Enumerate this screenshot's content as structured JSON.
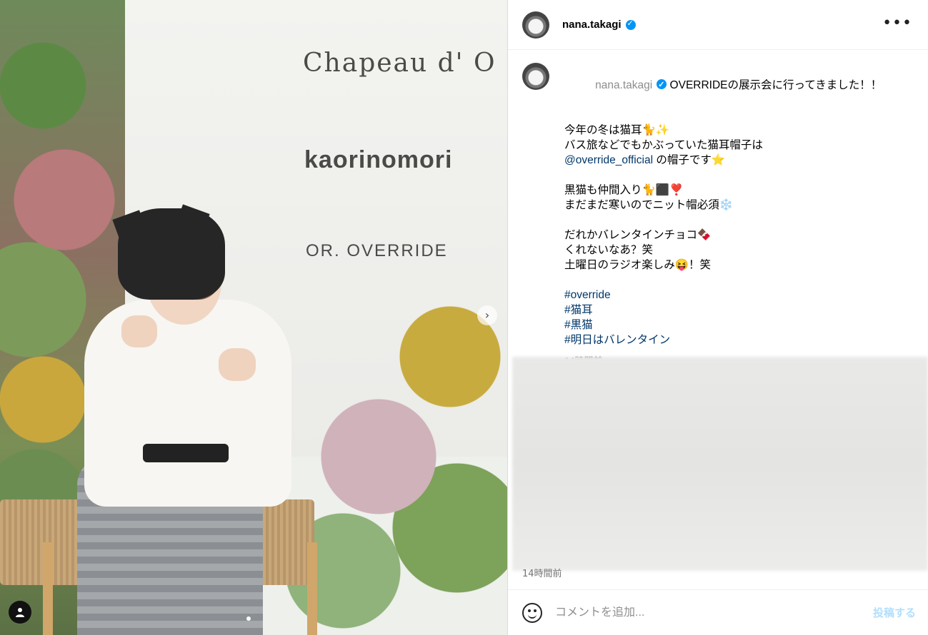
{
  "photo": {
    "brands": [
      "Chapeau d' O",
      "kaorinomori",
      "OR. OVERRIDE"
    ],
    "next_icon": "chevron-right-icon",
    "user_tag_icon": "person-icon"
  },
  "header": {
    "username": "nana.takagi",
    "verified": true,
    "more_icon": "more-horizontal-icon"
  },
  "caption": {
    "username": "nana.takagi",
    "first_line": "OVERRIDEの展示会に行ってきました！！",
    "lines_a": [
      "今年の冬は猫耳🐈✨",
      "バス旅などでもかぶっていた猫耳帽子は"
    ],
    "mention": "@override_official",
    "mention_suffix": " の帽子です⭐",
    "lines_b": [
      "黒猫も仲間入り🐈⬛❣️",
      "まだまだ寒いのでニット帽必須❄️"
    ],
    "lines_c": [
      "だれかバレンタインチョコ🍫",
      "くれないなあ？笑",
      "土曜日のラジオ楽しみ😝！笑"
    ],
    "hashtags": [
      "#override",
      "#猫耳",
      "#黒猫",
      "#明日はバレンタイン"
    ],
    "time": "14時間前"
  },
  "blurred_time": "14時間前",
  "footer": {
    "emoji_icon": "smile-icon",
    "comment_placeholder": "コメントを追加...",
    "post_label": "投稿する"
  },
  "colors": {
    "link": "#00376b",
    "verified": "#0095f6",
    "post_disabled": "#b2dffc"
  }
}
